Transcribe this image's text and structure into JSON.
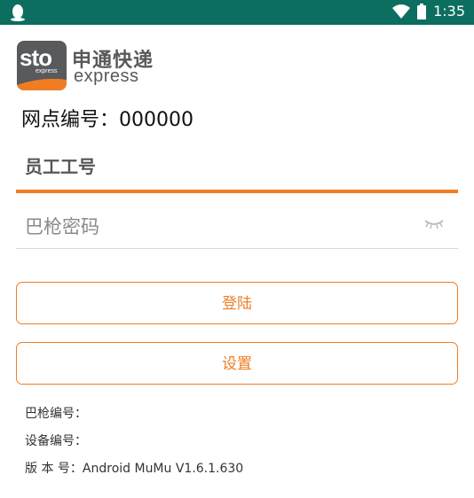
{
  "status_bar": {
    "time": "1:35",
    "icons": [
      "qq-penguin-icon",
      "wifi-icon",
      "battery-icon"
    ]
  },
  "logo": {
    "badge_text": "sto",
    "badge_subtext": "express",
    "cn_name": "申通快递",
    "en_name": "express"
  },
  "site": {
    "label": "网点编号：",
    "value": "000000"
  },
  "form": {
    "employee_id_placeholder": "员工工号",
    "password_placeholder": "巴枪密码"
  },
  "buttons": {
    "login": "登陆",
    "settings": "设置"
  },
  "info": {
    "scanner_no_label": "巴枪编号：",
    "device_no_label": "设备编号：",
    "version_label": "版 本 号：",
    "version_value": "Android MuMu V1.6.1.630"
  },
  "colors": {
    "status_bar": "#0c6e5f",
    "accent": "#f07d23",
    "logo_gray": "#585a5c"
  }
}
